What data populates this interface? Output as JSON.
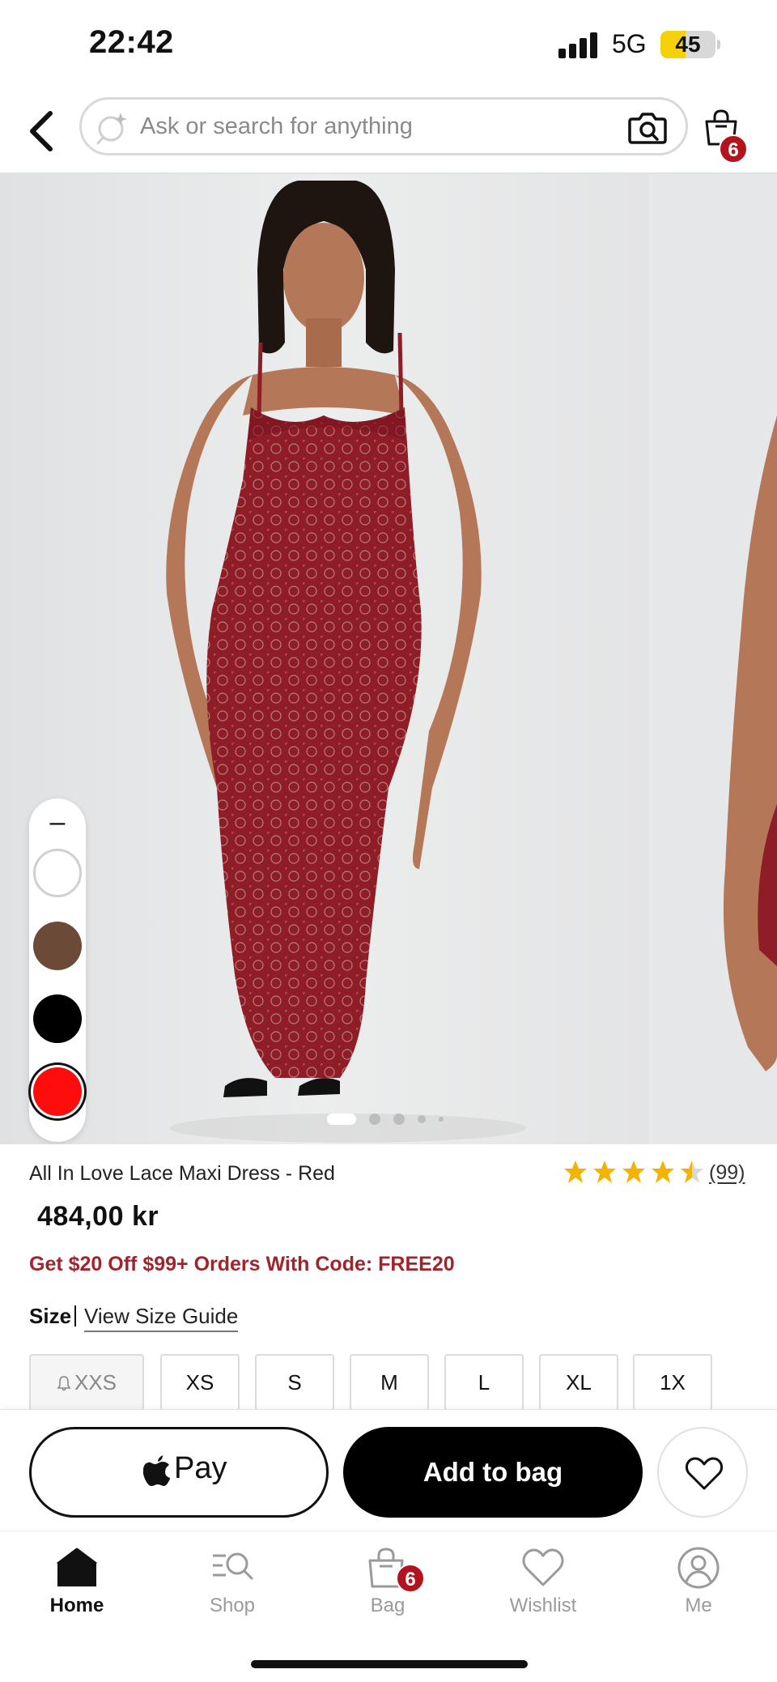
{
  "status_bar": {
    "time": "22:42",
    "network": "5G",
    "battery_percent": "45",
    "battery_level": 0.45,
    "battery_color": "#f6d10a"
  },
  "header": {
    "back_icon": "chevron-left-icon",
    "search_placeholder": "Ask or search for anything",
    "search_icon": "ai-sparkle-search-icon",
    "camera_icon": "camera-search-icon",
    "bag_icon": "shopping-bag-icon",
    "bag_count": "6"
  },
  "gallery": {
    "image_count": 5,
    "active_index": 0,
    "swatch_collapse_label": "–",
    "swatches": [
      {
        "name": "White",
        "color": "#ffffff",
        "selected": false
      },
      {
        "name": "Brown",
        "color": "#6b4a38",
        "selected": false
      },
      {
        "name": "Black",
        "color": "#000000",
        "selected": false
      },
      {
        "name": "Red",
        "color": "#ff0d0d",
        "selected": true
      }
    ]
  },
  "product": {
    "title": "All In Love Lace Maxi Dress - Red",
    "rating": 4.5,
    "review_count": "(99)",
    "price": "484,00 kr",
    "promo": "Get $20 Off $99+ Orders With Code: FREE20",
    "accent_color": "#a3232c",
    "star_color": "#f5b301"
  },
  "size": {
    "label": "Size",
    "guide_link": "View Size Guide",
    "options": [
      {
        "label": "XXS",
        "out_of_stock": true
      },
      {
        "label": "XS",
        "out_of_stock": false
      },
      {
        "label": "S",
        "out_of_stock": false
      },
      {
        "label": "M",
        "out_of_stock": false
      },
      {
        "label": "L",
        "out_of_stock": false
      },
      {
        "label": "XL",
        "out_of_stock": false
      },
      {
        "label": "1X",
        "out_of_stock": false
      }
    ]
  },
  "actions": {
    "apple_pay_label": "Pay",
    "add_to_bag_label": "Add to bag",
    "wishlist_icon": "heart-outline-icon"
  },
  "tab_bar": {
    "tabs": [
      {
        "label": "Home",
        "icon": "home-icon",
        "active": true
      },
      {
        "label": "Shop",
        "icon": "shop-search-icon",
        "active": false
      },
      {
        "label": "Bag",
        "icon": "bag-icon",
        "active": false,
        "badge": "6"
      },
      {
        "label": "Wishlist",
        "icon": "heart-icon",
        "active": false
      },
      {
        "label": "Me",
        "icon": "user-icon",
        "active": false
      }
    ]
  }
}
